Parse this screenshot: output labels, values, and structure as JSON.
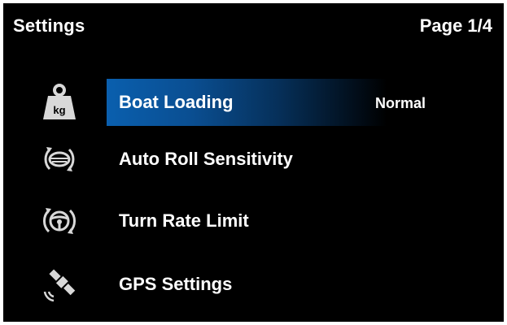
{
  "header": {
    "title": "Settings",
    "page_indicator": "Page 1/4"
  },
  "menu": {
    "items": [
      {
        "label": "Boat Loading",
        "value": "Normal",
        "icon": "kg-weight-icon",
        "selected": true
      },
      {
        "label": "Auto Roll Sensitivity",
        "icon": "auto-roll-icon",
        "selected": false
      },
      {
        "label": "Turn Rate Limit",
        "icon": "steering-wheel-icon",
        "selected": false
      },
      {
        "label": "GPS Settings",
        "icon": "gps-satellite-icon",
        "selected": false
      }
    ]
  },
  "colors": {
    "background": "#000000",
    "highlight": "#0a5fae",
    "text": "#ffffff"
  }
}
